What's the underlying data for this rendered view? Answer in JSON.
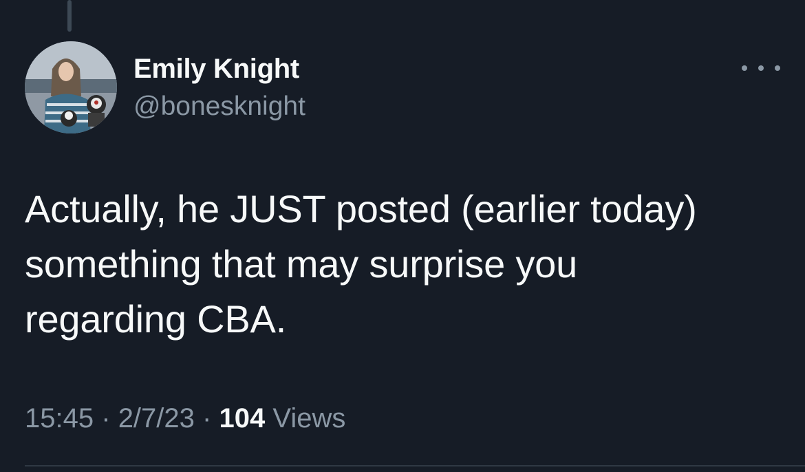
{
  "tweet": {
    "author": {
      "display_name": "Emily Knight",
      "handle": "@bonesknight"
    },
    "text": "Actually, he JUST posted (earlier today) something that may surprise you regarding CBA.",
    "time": "15:45",
    "separator": "·",
    "date": "2/7/23",
    "views_count": "104",
    "views_label": "Views"
  },
  "icons": {
    "more": "more-horizontal-icon"
  },
  "colors": {
    "background": "#161c26",
    "primary_text": "#f7f9f9",
    "secondary_text": "#8b98a5"
  }
}
